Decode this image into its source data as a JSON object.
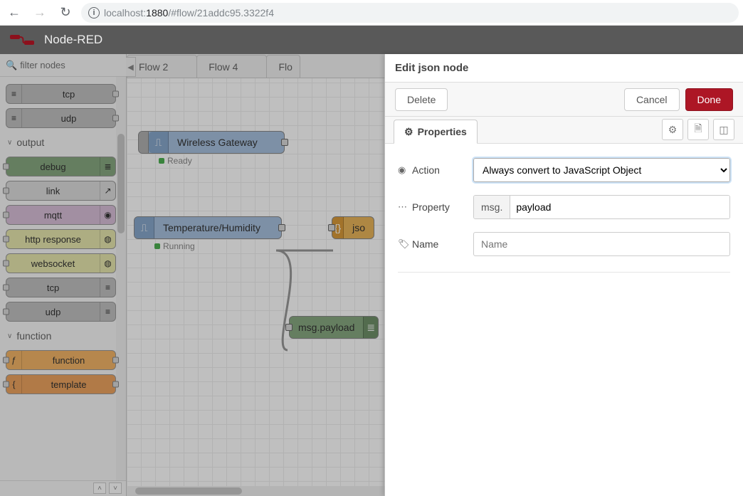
{
  "browser": {
    "url_host": "localhost:",
    "url_port": "1880",
    "url_path": "/#flow/21addc95.3322f4"
  },
  "header": {
    "title": "Node-RED"
  },
  "palette": {
    "filter_placeholder": "filter nodes",
    "categories": {
      "output": "output",
      "function": "function"
    },
    "nodes": {
      "tcp": "tcp",
      "udp": "udp",
      "debug": "debug",
      "link": "link",
      "mqtt": "mqtt",
      "http_response": "http response",
      "websocket": "websocket",
      "tcp2": "tcp",
      "udp2": "udp",
      "function": "function",
      "template": "template"
    }
  },
  "tabs": {
    "t1": "Flow 2",
    "t2": "Flow 4",
    "t3": "Flo"
  },
  "flow": {
    "gateway": {
      "label": "Wireless Gateway",
      "status": "Ready"
    },
    "temp": {
      "label": "Temperature/Humidity",
      "status": "Running"
    },
    "json": {
      "label": "jso"
    },
    "debug": {
      "label": "msg.payload"
    }
  },
  "edit": {
    "title": "Edit json node",
    "delete": "Delete",
    "cancel": "Cancel",
    "done": "Done",
    "tab_properties": "Properties",
    "action_label": "Action",
    "action_value": "Always convert to JavaScript Object",
    "property_label": "Property",
    "property_prefix": "msg.",
    "property_value": "payload",
    "name_label": "Name",
    "name_placeholder": "Name"
  }
}
